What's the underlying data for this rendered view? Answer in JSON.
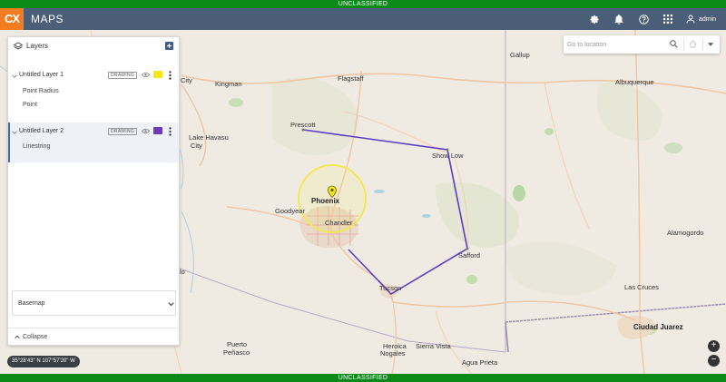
{
  "classification": {
    "top": "UNCLASSIFIED",
    "bottom": "UNCLASSIFIED"
  },
  "app": {
    "logo": "CX",
    "title": "MAPS"
  },
  "header": {
    "icons": [
      "gear-icon",
      "bell-icon",
      "help-icon",
      "apps-grid-icon",
      "user-icon"
    ],
    "user_name": "admin"
  },
  "layers_panel": {
    "title": "Layers",
    "layers": [
      {
        "name": "Untitled Layer 1",
        "type_badge": "DRAWING",
        "color": "#f5e81a",
        "features": [
          "Point Radius",
          "Point"
        ]
      },
      {
        "name": "Untitled Layer 2",
        "type_badge": "DRAWING",
        "color": "#6a3bb5",
        "features": [
          "Linestring"
        ]
      }
    ],
    "basemap_label": "Basemap",
    "collapse_label": "Collapse"
  },
  "search": {
    "placeholder": "Go to location"
  },
  "coordinates": "35°28'43\" N 107°57'20\" W",
  "zoom": {
    "in": "+",
    "out": "−"
  },
  "map_labels": {
    "gallup": "Gallup",
    "kingman": "Kingman",
    "flagstaff": "Flagstaff",
    "albuquerque": "Albuquerque",
    "city": "City",
    "lake_havasu": "Lake Havasu",
    "lake_havasu_city": "City",
    "prescott": "Prescott",
    "show_low": "Show Low",
    "phoenix": "Phoenix",
    "goodyear": "Goodyear",
    "chandler": "Chandler",
    "safford": "Safford",
    "alamogordo": "Alamogordo",
    "tucson": "Tucson",
    "las_cruces": "Las Cruces",
    "nogales": "Nogales",
    "heroica": "Heroica",
    "sierra_vista": "Sierra Vista",
    "ciudad_juarez": "Ciudad Juarez",
    "puerto_penasco_1": "Puerto",
    "puerto_penasco_2": "Peñasco",
    "agua_prieta": "Agua Prieta",
    "lo": "lo"
  },
  "colors": {
    "accent": "#f47b20",
    "header": "#4a5e78",
    "classification": "#0b8a1a",
    "linestring": "#5b3cc4",
    "radius": "#f2e84a"
  }
}
